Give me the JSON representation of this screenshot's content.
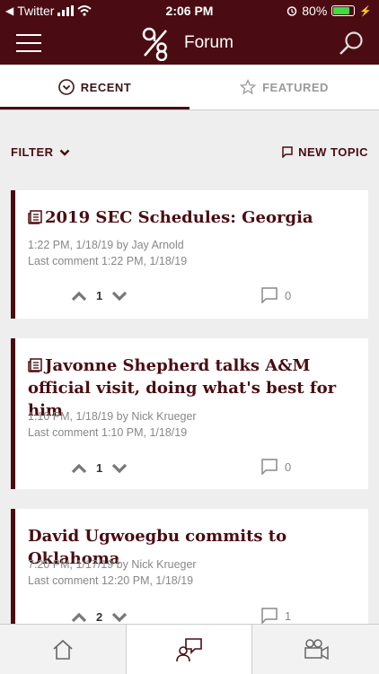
{
  "status_bar": {
    "carrier": "Twitter",
    "time": "2:06 PM",
    "battery": "80%",
    "battery_level": 0.8
  },
  "app_bar": {
    "logo": "9/8",
    "title": "Forum"
  },
  "tabs": [
    {
      "label": "RECENT",
      "icon": "chevron-circle-down-icon",
      "active": true
    },
    {
      "label": "FEATURED",
      "icon": "star-icon",
      "active": false
    }
  ],
  "filter": {
    "label": "FILTER"
  },
  "new_topic": {
    "label": "NEW TOPIC"
  },
  "posts": [
    {
      "title": "2019 SEC Schedules: Georgia",
      "byline": "1:22 PM, 1/18/19 by Jay Arnold",
      "last_comment": "Last comment 1:22 PM, 1/18/19",
      "votes": "1",
      "comments": "0",
      "has_doc_icon": true
    },
    {
      "title": "Javonne Shepherd talks A&M official visit, doing what's best for him",
      "byline": "1:10 PM, 1/18/19 by Nick Krueger",
      "last_comment": "Last comment 1:10 PM, 1/18/19",
      "votes": "1",
      "comments": "0",
      "has_doc_icon": true
    },
    {
      "title": "David Ugwoegbu commits to Oklahoma",
      "byline": "7:20 PM, 1/17/19 by Nick Krueger",
      "last_comment": "Last comment 12:20 PM, 1/18/19",
      "votes": "2",
      "comments": "1",
      "has_doc_icon": false
    }
  ],
  "bottom_nav": [
    {
      "icon": "home-icon",
      "active": false
    },
    {
      "icon": "forum-icon",
      "active": true
    },
    {
      "icon": "video-camera-icon",
      "active": false
    }
  ],
  "colors": {
    "brand": "#4a0c12",
    "battery": "#3ddc40"
  }
}
